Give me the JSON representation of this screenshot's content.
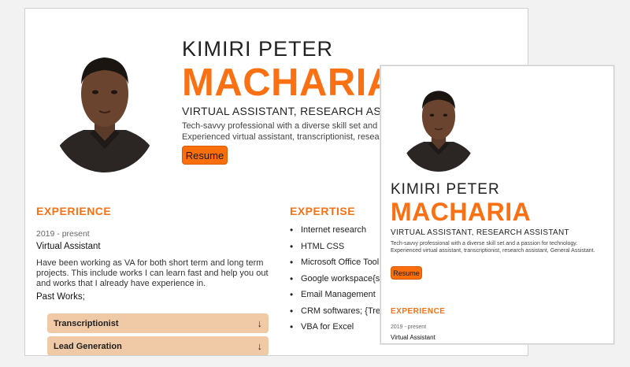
{
  "profile": {
    "first_name": "KIMIRI PETER",
    "last_name": "MACHARIA",
    "role_full": "VIRTUAL ASSISTANT, RESEARCH ASSISTANT",
    "role_desktop": "VIRTUAL ASSISTANT, RESEARCH ASSIS",
    "bio_desktop": [
      "Tech-savvy professional with a diverse skill set and a",
      "Experienced virtual assistant, transcriptionist, resear"
    ],
    "bio_mobile": "Tech-savvy professional with a diverse skill set and a passion for technology. Experienced virtual assistant, transcriptionist, research assistant, General Assistant.",
    "resume_label": "Resume"
  },
  "experience": {
    "title": "EXPERIENCE",
    "date": "2019 - present",
    "job_title": "Virtual Assistant",
    "description": "Have been working as VA for both short term and long term projects. This include works I can learn fast and help you out and works that I already have experience in.",
    "past_works_label": "Past Works;",
    "past_works": [
      {
        "label": "Transcriptionist",
        "arrow": "↓"
      },
      {
        "label": "Lead Generation",
        "arrow": "↓"
      }
    ]
  },
  "expertise": {
    "title": "EXPERTISE",
    "items": [
      "Internet research",
      "HTML CSS",
      "Microsoft Office Tool",
      "Google workspace{sp",
      "Email Management",
      "CRM softwares; {Trel",
      "VBA for Excel"
    ]
  }
}
